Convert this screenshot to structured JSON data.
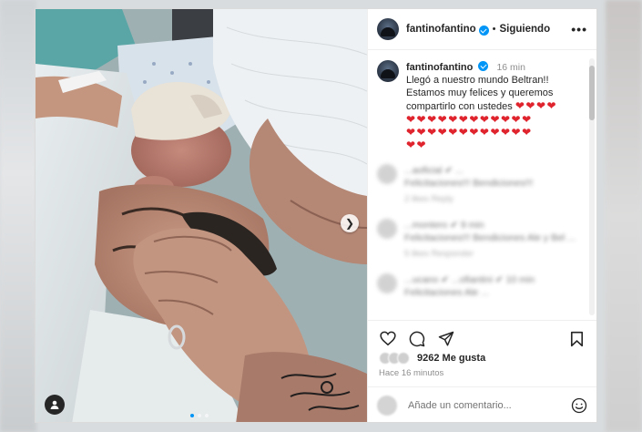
{
  "post": {
    "author": "fantinofantino",
    "follow_status": "Siguiendo",
    "separator": "•",
    "more_label": "•••"
  },
  "caption": {
    "author": "fantinofantino",
    "time": "16 min",
    "line1": "Llegó a nuestro mundo Beltran!!",
    "line2": "Estamos muy felices y queremos",
    "line3": "compartirlo con ustedes",
    "hearts_inline": "❤❤❤❤",
    "hearts_row1": "❤❤❤❤❤❤❤❤❤❤❤❤",
    "hearts_row2": "❤❤❤❤❤❤❤❤❤❤❤❤",
    "hearts_row3": "❤❤"
  },
  "comments_blurred": [
    {
      "text": "...aoficial ✔ ...",
      "body": "Felicitaciones!!! Bendiciones!!!",
      "sub": "2 likes  Reply"
    },
    {
      "text": "...montero ✔ 9 min",
      "body": "Felicitaciones!!! Bendiciones Ale y Bel ...",
      "sub": "5 likes  Responder"
    },
    {
      "text": "...ucano ✔ ...ofiantini ✔ 10 min",
      "body": "Felicitaciones Ale ...",
      "sub": ""
    }
  ],
  "stats": {
    "likes": "9262 Me gusta",
    "posted": "Hace 16 minutos"
  },
  "comment_box": {
    "placeholder": "Añade un comentario..."
  },
  "icons": {
    "like": "heart-icon",
    "comment": "comment-icon",
    "share": "share-icon",
    "save": "bookmark-icon",
    "emoji": "emoji-icon",
    "next": "chevron-right-icon",
    "tagged": "user-tag-icon"
  },
  "colors": {
    "verified": "#0095f6",
    "heart": "#e0242e",
    "text": "#262626",
    "muted": "#8e8e8e"
  },
  "carousel": {
    "current": 1,
    "total": 3
  }
}
